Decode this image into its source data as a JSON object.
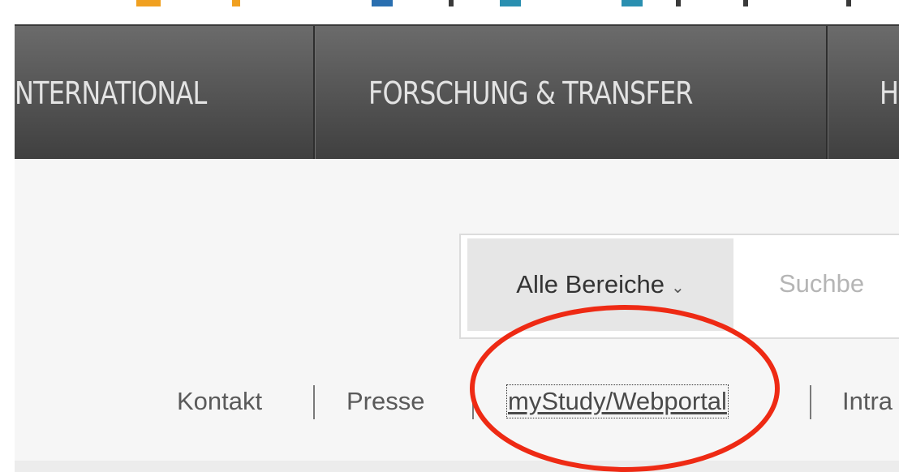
{
  "navigation": {
    "items": [
      {
        "label": "NTERNATIONAL"
      },
      {
        "label": "FORSCHUNG & TRANSFER"
      },
      {
        "label": "H"
      }
    ]
  },
  "search": {
    "scope_label": "Alle Bereiche",
    "scope_chevron": "⌄",
    "placeholder": "Suchbe"
  },
  "service_links": [
    {
      "label": "Kontakt"
    },
    {
      "label": "Presse"
    },
    {
      "label": "myStudy/Webportal"
    },
    {
      "label": "Intra"
    }
  ],
  "annotation": {
    "shape": "ellipse",
    "color": "#ee2a14",
    "target": "myStudy/Webportal"
  },
  "colors": {
    "nav_background": "#575757",
    "nav_text": "#e3e3e3",
    "page_background": "#f6f6f6",
    "link_text": "#5a5a5a"
  }
}
